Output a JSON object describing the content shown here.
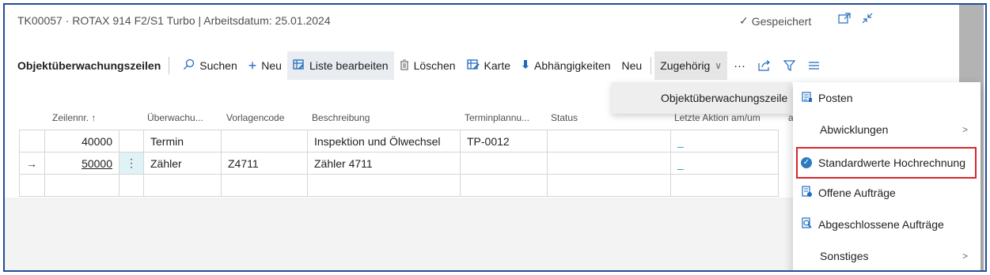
{
  "header": {
    "title": "TK00057 · ROTAX 914 F2/S1 Turbo | Arbeitsdatum: 25.01.2024",
    "saved_label": "Gespeichert"
  },
  "actionbar": {
    "title": "Objektüberwachungszeilen",
    "search": "Suchen",
    "new": "Neu",
    "edit_list": "Liste bearbeiten",
    "delete": "Löschen",
    "card": "Karte",
    "dependencies": "Abhängigkeiten",
    "new2": "Neu",
    "related": "Zugehörig",
    "more": "···"
  },
  "grid": {
    "columns": [
      "Zeilennr. ↑",
      "Überwachu...",
      "Vorlagencode",
      "Beschreibung",
      "Terminplannu...",
      "Status",
      "Letzte Aktion am/um",
      "a"
    ],
    "rows": [
      {
        "marker": "",
        "line_no": "40000",
        "type": "Termin",
        "template": "",
        "description": "Inspektion und Ölwechsel",
        "schedule": "TP-0012",
        "status": "",
        "last_action": "_"
      },
      {
        "marker": "→",
        "line_no": "50000",
        "type": "Zähler",
        "template": "Z4711",
        "description": "Zähler 4711",
        "schedule": "",
        "status": "",
        "last_action": "_"
      }
    ]
  },
  "submenu_parent": {
    "label": "Objektüberwachungszeile"
  },
  "menu": {
    "items": [
      {
        "label": "Posten",
        "icon": "ledger-icon"
      },
      {
        "label": "Abwicklungen",
        "icon": ""
      },
      {
        "label": "Standardwerte Hochrechnung",
        "icon": "check-circle-icon"
      },
      {
        "label": "Offene Aufträge",
        "icon": "open-orders-icon"
      },
      {
        "label": "Abgeschlossene Aufträge",
        "icon": "closed-orders-icon"
      },
      {
        "label": "Sonstiges",
        "icon": ""
      }
    ]
  },
  "colors": {
    "accent": "#1f6bbf",
    "frame": "#1f4e96",
    "highlight_box": "#d8262d"
  }
}
